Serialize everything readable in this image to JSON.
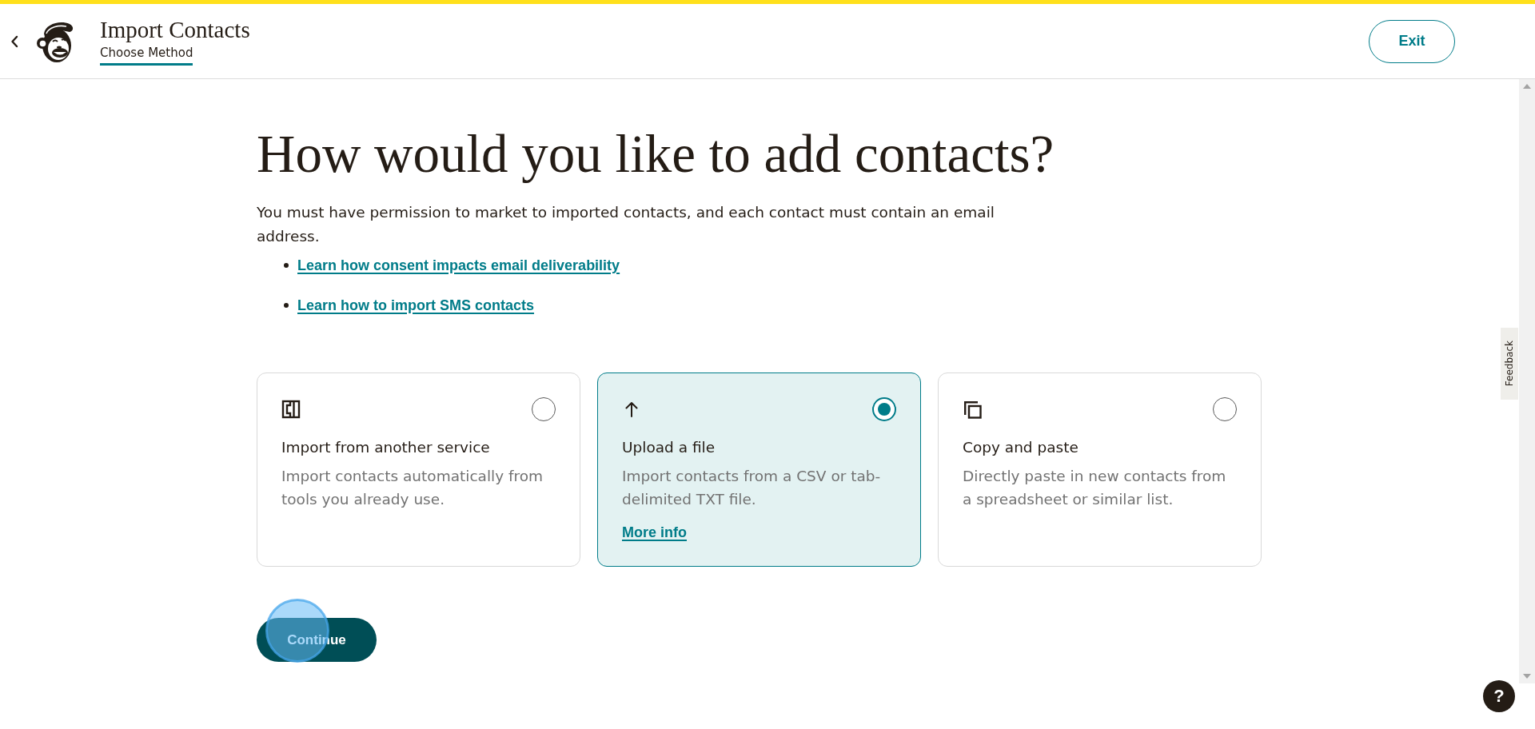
{
  "header": {
    "title": "Import Contacts",
    "step": "Choose Method",
    "exit_button": "Exit"
  },
  "intro": {
    "heading": "How would you like to add contacts?",
    "text": "You must have permission to market to imported contacts, and each contact must contain an email address.",
    "links": [
      "Learn how consent impacts email deliverability",
      "Learn how to import SMS contacts"
    ]
  },
  "options": [
    {
      "title": "Import from another service",
      "description": "Import contacts automatically from tools you already use.",
      "selected": false
    },
    {
      "title": "Upload a file",
      "description": "Import contacts from a CSV or tab-delimited TXT file.",
      "link": "More info",
      "selected": true
    },
    {
      "title": "Copy and paste",
      "description": "Directly paste in new contacts from a spreadsheet or similar list.",
      "selected": false
    }
  ],
  "continue_button": "Continue",
  "feedback_tab": "Feedback",
  "help_button": "?"
}
